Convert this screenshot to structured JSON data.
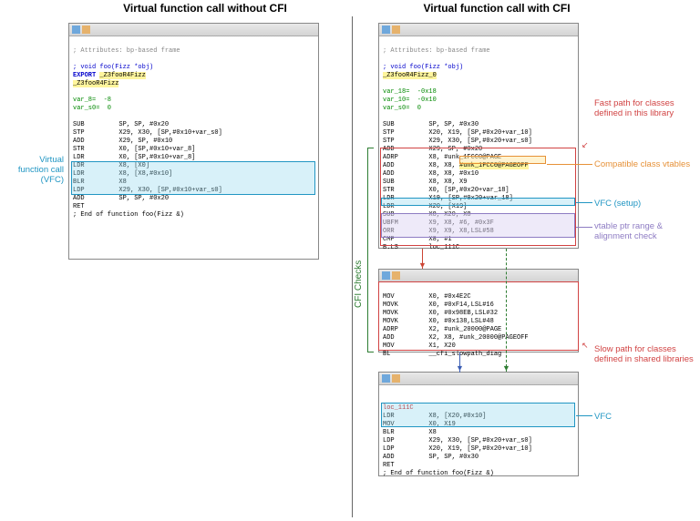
{
  "titles": {
    "left": "Virtual function call without CFI",
    "right": "Virtual function call with CFI"
  },
  "left_pane": {
    "attr": "; Attributes: bp-based frame",
    "decl": "; void foo(Fizz *obj)",
    "export": "EXPORT ",
    "export_sym": "_Z3fooR4Fizz",
    "label": "_Z3fooR4Fizz",
    "vars": "var_8=  -8\nvar_s0=  0",
    "code1": "SUB         SP, SP, #0x20\nSTP         X29, X30, [SP,#0x10+var_s0]\nADD         X29, SP, #0x10\nSTR         X0, [SP,#0x10+var_8]",
    "vfc1": "LDR         X0, [SP,#0x10+var_8]\nLDR         X8, [X0]\nLDR         X8, [X8,#0x10]\nBLR         X8",
    "code2": "LDP         X29, X30, [SP,#0x10+var_s0]\nADD         SP, SP, #0x20\nRET\n; End of function foo(Fizz &)"
  },
  "right_p1": {
    "attr": "; Attributes: bp-based frame",
    "decl": "; void foo(Fizz *obj)",
    "label": "_Z3fooR4Fizz_0",
    "vars": "var_18=  -0x18\nvar_10=  -0x10\nvar_s0=  0",
    "pre": "SUB         SP, SP, #0x30\nSTP         X20, X19, [SP,#0x20+var_10]\nSTP         X29, X30, [SP,#0x20+var_s0]\nADD         X29, SP, #0x20",
    "fast_a": "ADRP        X8, #unk_1FCC0@PAGE\nADD         X8, X8, ",
    "fast_compat": "#unk_1FCC0@PAGEOFF",
    "fast_b": "ADD         X8, X8, #0x10\nSUB         X8, X8, X9",
    "store": "STR         X0, [SP,#0x20+var_18]\nLDR         X19, [SP,#0x20+var_18]",
    "vfc_setup": "LDR         X20, [X19]",
    "sub": "SUB         X8, X20, X8",
    "range": "UBFM        X9, X8, #6, #0x3F\nORR         X9, X9, X8,LSL#58\nCMP         X8, #1",
    "bls": "B.LS        loc_111C"
  },
  "right_p2": {
    "code": "MOV         X0, #0x4E2C\nMOVK        X0, #0xF14,LSL#16\nMOVK        X0, #0x98EB,LSL#32\nMOVK        X0, #0x138,LSL#48\nADRP        X2, #unk_20000@PAGE\nADD         X2, X8, #unk_20000@PAGEOFF\nMOV         X1, X20\nBL          __cfi_slowpath_diag"
  },
  "right_p3": {
    "loc": "loc_111C",
    "vfc": "LDR         X8, [X20,#0x10]\nMOV         X0, X19\nBLR         X8",
    "tail": "LDP         X29, X30, [SP,#0x20+var_s0]\nLDP         X20, X19, [SP,#0x20+var_10]\nADD         SP, SP, #0x30\nRET\n; End of function foo(Fizz &)"
  },
  "labels": {
    "vfc_left": "Virtual\nfunction\ncall (VFC)",
    "fast": "Fast path for\nclasses defined\nin this library",
    "compat": "Compatible\nclass vtables",
    "setup": "VFC (setup)",
    "range": "vtable ptr range &\nalignment check",
    "cfi": "CFI Checks",
    "slow": "Slow path for\nclasses defined in\nshared libraries",
    "vfc_right": "VFC"
  }
}
